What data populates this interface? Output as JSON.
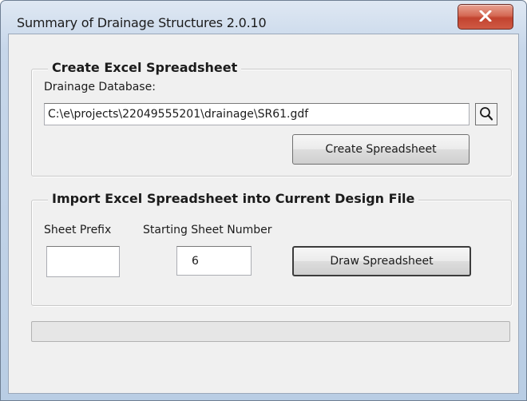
{
  "window": {
    "title": "Summary of Drainage Structures 2.0.10",
    "close_icon": "close-icon"
  },
  "create_group": {
    "title": "Create Excel Spreadsheet",
    "database_label": "Drainage Database:",
    "database_value": "C:\\e\\projects\\22049555201\\drainage\\SR61.gdf",
    "browse_icon": "search-icon",
    "create_button_label": "Create Spreadsheet"
  },
  "import_group": {
    "title": "Import Excel Spreadsheet into Current Design File",
    "sheet_prefix_label": "Sheet Prefix",
    "sheet_prefix_value": "",
    "starting_sheet_label": "Starting Sheet Number",
    "starting_sheet_value": "6",
    "draw_button_label": "Draw Spreadsheet"
  },
  "progress": {
    "fraction": 0
  }
}
